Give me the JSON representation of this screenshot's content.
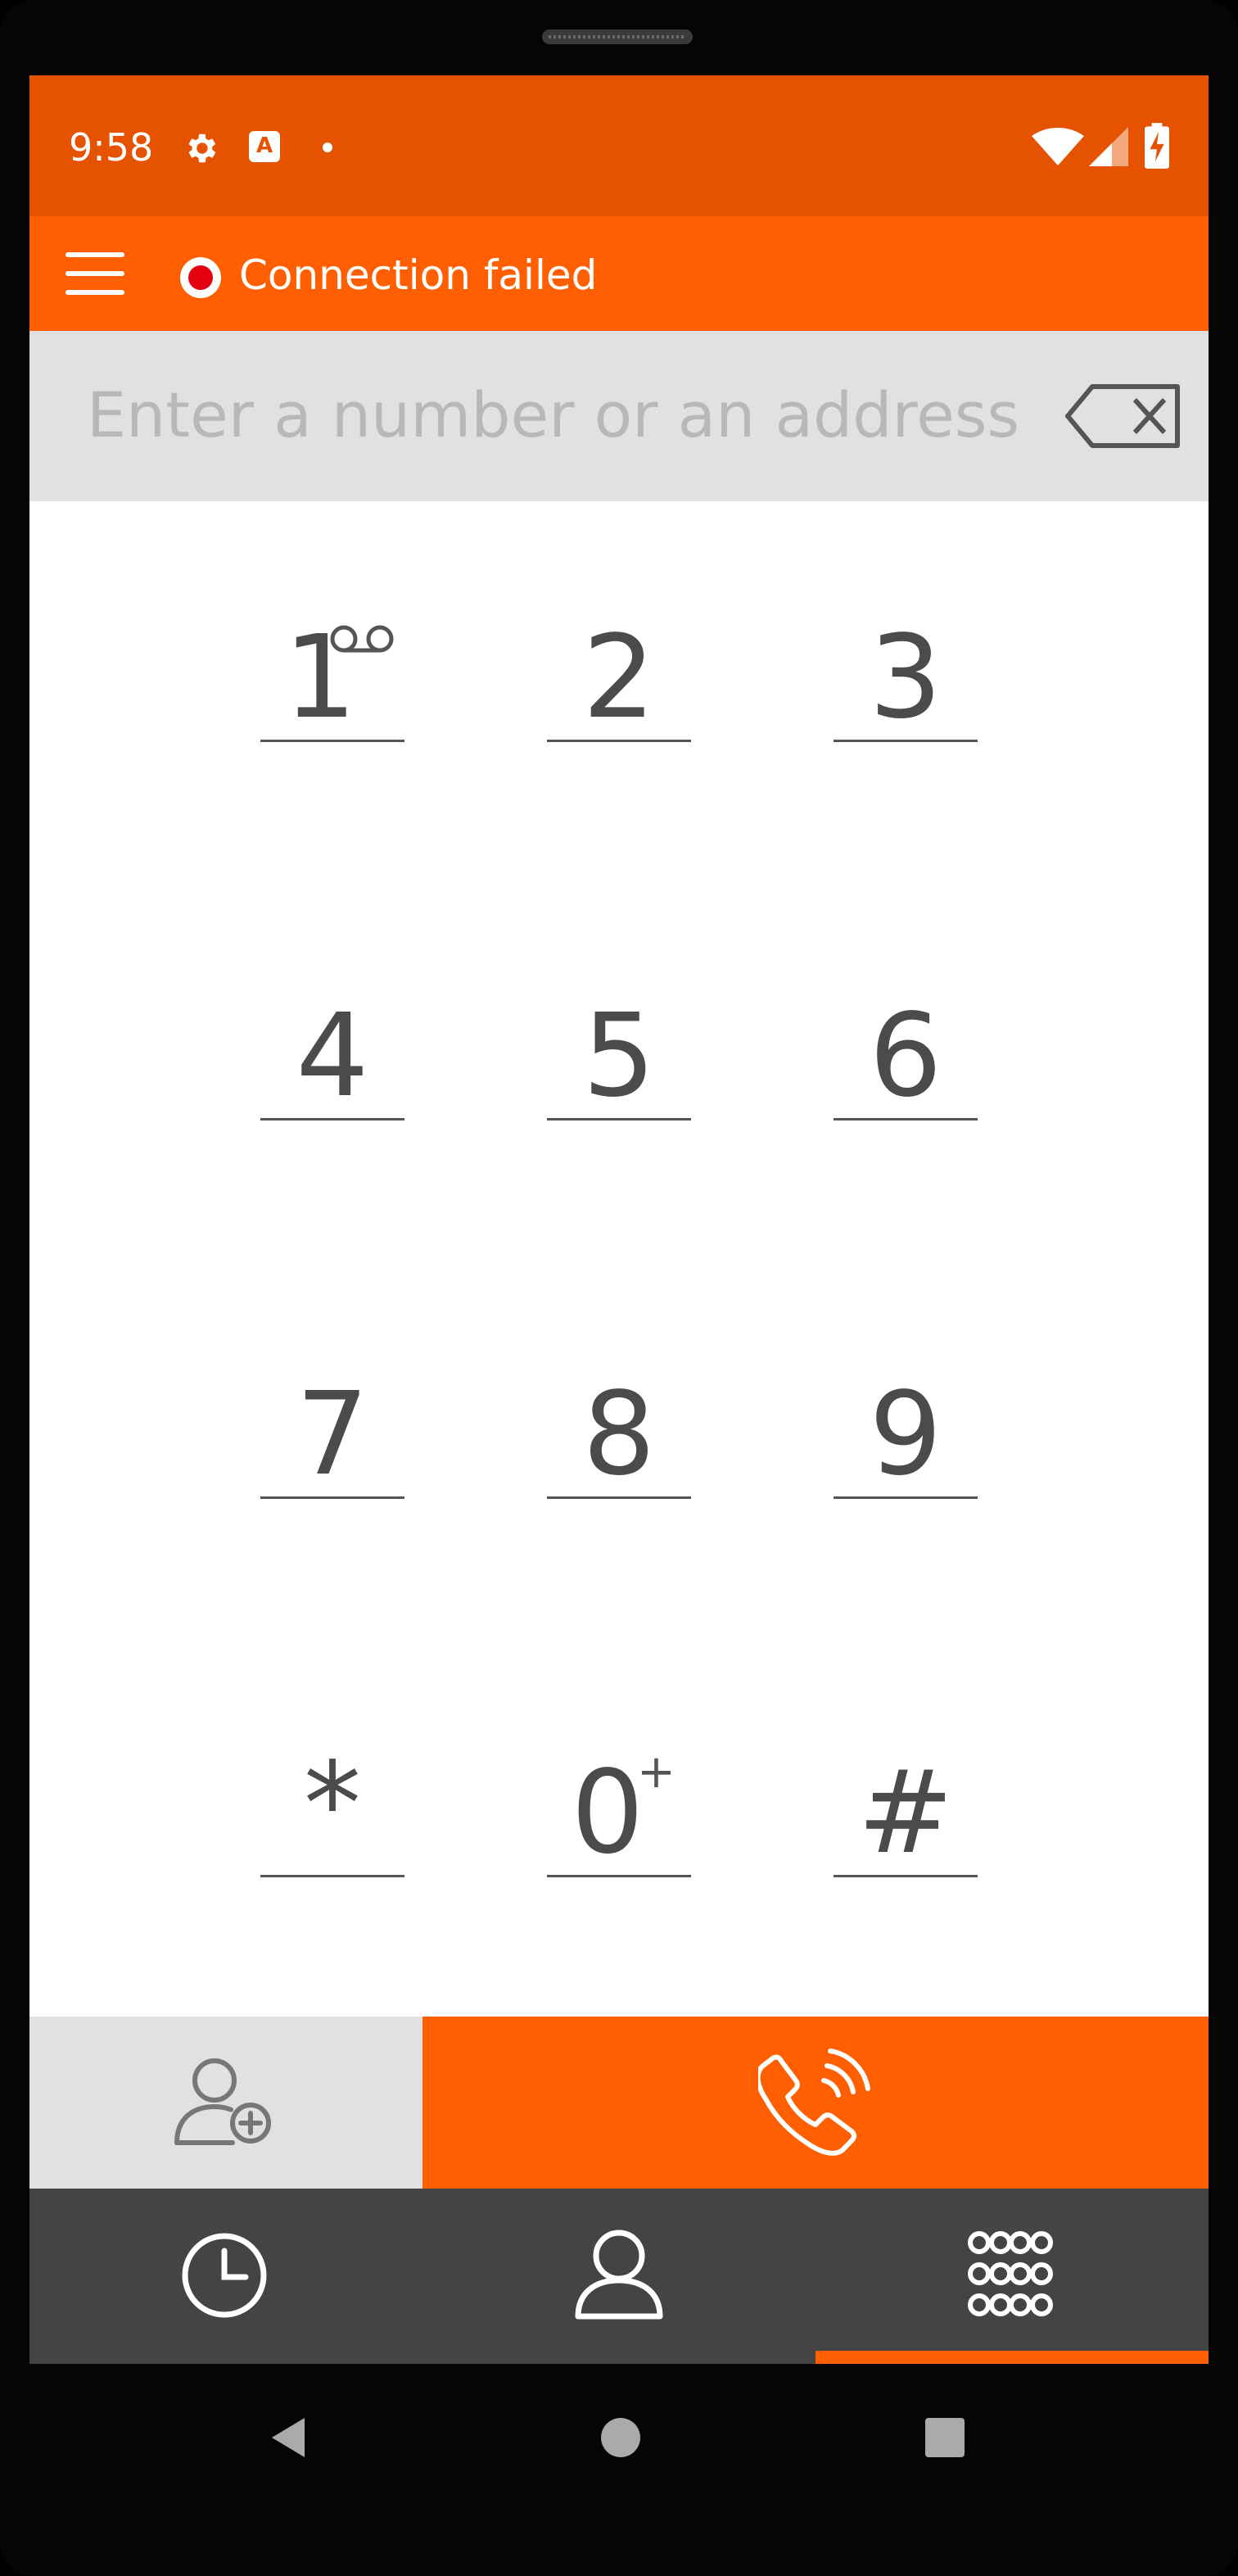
{
  "status_bar": {
    "time": "9:58",
    "icons": [
      "gear-icon",
      "keyboard-a-icon",
      "notification-dot-icon",
      "wifi-icon",
      "cell-signal-icon",
      "battery-charging-icon"
    ]
  },
  "app_bar": {
    "menu_icon": "hamburger-menu-icon",
    "connection_status": "Connection failed",
    "status_color": "#e3000f"
  },
  "dial_input": {
    "value": "",
    "placeholder": "Enter a number or an address",
    "backspace_icon": "backspace-icon"
  },
  "keypad": {
    "keys": [
      {
        "digit": "1",
        "sup": "voicemail-icon"
      },
      {
        "digit": "2"
      },
      {
        "digit": "3"
      },
      {
        "digit": "4"
      },
      {
        "digit": "5"
      },
      {
        "digit": "6"
      },
      {
        "digit": "7"
      },
      {
        "digit": "8"
      },
      {
        "digit": "9"
      },
      {
        "digit": "*"
      },
      {
        "digit": "0",
        "sup": "+"
      },
      {
        "digit": "#"
      }
    ]
  },
  "actions": {
    "add_contact_icon": "add-contact-icon",
    "call_icon": "call-icon"
  },
  "bottom_nav": {
    "tabs": [
      {
        "icon": "history-clock-icon"
      },
      {
        "icon": "contacts-icon"
      },
      {
        "icon": "dialpad-icon",
        "selected": true
      }
    ]
  },
  "system_nav": {
    "buttons": [
      "back-icon",
      "home-icon",
      "recents-icon"
    ]
  },
  "colors": {
    "status_bar": "#e55300",
    "accent": "#ff5f00",
    "input_background": "#e1e1e1",
    "nav_background": "#444444"
  }
}
